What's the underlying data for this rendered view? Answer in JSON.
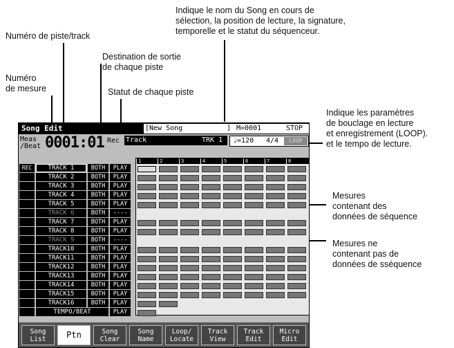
{
  "annotations": {
    "song_info": "Indique le nom du Song en cours de\nsélection, la position de lecture, la signature,\ntemporelle et le statut du séquenceur.",
    "track_number": "Numéro de piste/track",
    "output_dest": "Destination de sortie\nde chaque piste",
    "measure_number": "Numéro\nde mesure",
    "track_status": "Statut de chaque piste",
    "loop_params": "Indique les paramètres\nde bouclage en lecture\net enregistrement (LOOP).\net le tempo de lecture.",
    "with_data": "Mesures\ncontenant des\ndonnées de séquence",
    "without_data": "Mesures ne\ncontenant pas de\ndonnées de sséquence"
  },
  "screen": {
    "title": "Song Edit",
    "song_name": "[New Song",
    "song_name_close": "]",
    "measure_pos": "M=0001",
    "status": "STOP",
    "meas_label": "Meas\n/Beat",
    "meas_value": "0001:01",
    "rec_label": "Rec",
    "rec_track_label": "Track",
    "rec_track_value": "TRK 1",
    "tempo": "♩=120",
    "signature": "4/4",
    "loop": "LOOP",
    "rec_column": "REC",
    "tracks": [
      {
        "name": "TRACK 1",
        "out": "BOTH",
        "status": "PLAY",
        "selected": true
      },
      {
        "name": "TRACK 2",
        "out": "BOTH",
        "status": "PLAY"
      },
      {
        "name": "TRACK 3",
        "out": "BOTH",
        "status": "PLAY"
      },
      {
        "name": "TRACK 4",
        "out": "BOTH",
        "status": "PLAY"
      },
      {
        "name": "TRACK 5",
        "out": "BOTH",
        "status": "PLAY"
      },
      {
        "name": "TRACK 6",
        "out": "BOTH",
        "status": "----",
        "dim": true
      },
      {
        "name": "TRACK 7",
        "out": "BOTH",
        "status": "PLAY"
      },
      {
        "name": "TRACK 8",
        "out": "BOTH",
        "status": "PLAY"
      },
      {
        "name": "TRACK 9",
        "out": "BOTH",
        "status": "----",
        "dim": true
      },
      {
        "name": "TRACK10",
        "out": "BOTH",
        "status": "PLAY"
      },
      {
        "name": "TRACK11",
        "out": "BOTH",
        "status": "PLAY"
      },
      {
        "name": "TRACK12",
        "out": "BOTH",
        "status": "PLAY"
      },
      {
        "name": "TRACK13",
        "out": "BOTH",
        "status": "PLAY"
      },
      {
        "name": "TRACK14",
        "out": "BOTH",
        "status": "PLAY"
      },
      {
        "name": "TRACK15",
        "out": "BOTH",
        "status": "PLAY"
      },
      {
        "name": "TRACK16",
        "out": "BOTH",
        "status": "PLAY"
      },
      {
        "name": "TEMPO/BEAT",
        "out": "",
        "status": "PLAY",
        "tempo": true
      }
    ],
    "measures": [
      "1",
      "2",
      "3",
      "4",
      "5",
      "6",
      "7",
      "8"
    ],
    "grid": [
      [
        2,
        1,
        1,
        1,
        1,
        1,
        1,
        1
      ],
      [
        1,
        1,
        1,
        1,
        1,
        1,
        1,
        1
      ],
      [
        1,
        1,
        1,
        1,
        1,
        1,
        1,
        1
      ],
      [
        1,
        1,
        1,
        1,
        1,
        1,
        1,
        1
      ],
      [
        1,
        1,
        1,
        1,
        1,
        1,
        1,
        1
      ],
      [
        0,
        0,
        0,
        0,
        0,
        0,
        0,
        0
      ],
      [
        1,
        1,
        1,
        1,
        1,
        1,
        1,
        1
      ],
      [
        1,
        1,
        1,
        1,
        1,
        1,
        1,
        1
      ],
      [
        0,
        0,
        0,
        0,
        0,
        0,
        0,
        0
      ],
      [
        1,
        1,
        1,
        1,
        1,
        1,
        1,
        1
      ],
      [
        1,
        1,
        1,
        1,
        1,
        1,
        1,
        1
      ],
      [
        1,
        1,
        1,
        1,
        1,
        1,
        1,
        1
      ],
      [
        1,
        1,
        1,
        1,
        1,
        1,
        1,
        1
      ],
      [
        1,
        1,
        1,
        1,
        1,
        1,
        1,
        1
      ],
      [
        1,
        1,
        1,
        1,
        1,
        1,
        1,
        1
      ],
      [
        1,
        1,
        0,
        0,
        0,
        0,
        0,
        0
      ],
      [
        1,
        0,
        0,
        0,
        0,
        0,
        0,
        0
      ]
    ],
    "softkeys": [
      {
        "label": "Song\nList"
      },
      {
        "label": "Ptn",
        "active": true
      },
      {
        "label": "Song\nClear"
      },
      {
        "label": "Song\nName"
      },
      {
        "label": "Loop/\nLocate"
      },
      {
        "label": "Track\nView"
      },
      {
        "label": "Track\nEdit"
      },
      {
        "label": "Micro\nEdit"
      }
    ]
  }
}
